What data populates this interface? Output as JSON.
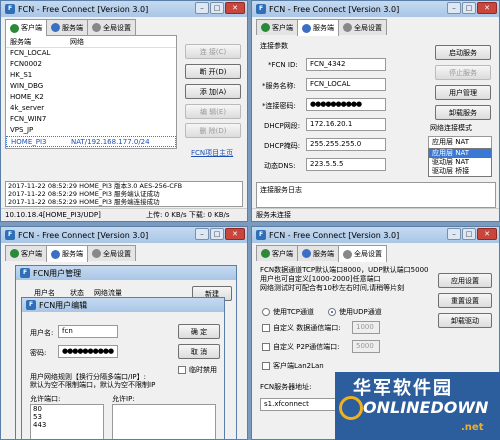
{
  "windows": {
    "tl": {
      "title": "FCN - Free Connect [Version 3.0]",
      "tabs": [
        "客户端",
        "服务端",
        "全局设置"
      ],
      "list_headers": [
        "服务端",
        "网络"
      ],
      "servers": [
        {
          "name": "FCN_LOCAL",
          "net": ""
        },
        {
          "name": "FCN0002",
          "net": ""
        },
        {
          "name": "HK_S1",
          "net": ""
        },
        {
          "name": "WIN_DBG",
          "net": ""
        },
        {
          "name": "HOME_K2",
          "net": ""
        },
        {
          "name": "4k_server",
          "net": ""
        },
        {
          "name": "FCN_WIN7",
          "net": ""
        },
        {
          "name": "VPS_JP",
          "net": ""
        },
        {
          "name": "HOME_PI3",
          "net": "NAT/192.168.177.0/24"
        }
      ],
      "buttons": {
        "connect": "连 接(C)",
        "disconnect": "断 开(D)",
        "add": "添 加(A)",
        "edit": "编 辑(E)",
        "delete": "删 除(D)"
      },
      "link": "FCN项目主页",
      "logs": [
        "2017-11-22 08:52:29 HOME_PI3 版本3.0 AES-256-CFB",
        "2017-11-22 08:52:29 HOME_PI3 服务端认证成功",
        "2017-11-22 08:52:29 HOME_PI3 服务端连接成功"
      ],
      "status_left": "10.10.18.4[HOME_PI3/UDP]",
      "status_right": "上传: 0 KB/s  下载: 0 KB/s"
    },
    "tr": {
      "title": "FCN - Free Connect [Version 3.0]",
      "tabs": [
        "客户端",
        "服务端",
        "全局设置"
      ],
      "section": "连接参数",
      "fields": [
        {
          "label": "*FCN ID:",
          "value": "FCN_4342"
        },
        {
          "label": "*服务名称:",
          "value": "FCN_LOCAL"
        },
        {
          "label": "*连接密码:",
          "value": "●●●●●●●●●●"
        },
        {
          "label": "DHCP网段:",
          "value": "172.16.20.1"
        },
        {
          "label": "DHCP掩码:",
          "value": "255.255.255.0"
        },
        {
          "label": "动态DNS:",
          "value": "223.5.5.5"
        }
      ],
      "buttons": {
        "start": "启动服务",
        "stop": "停止服务",
        "user": "用户管理",
        "uninstall": "卸载服务"
      },
      "mode_label": "网络连接模式",
      "mode_selected": "应用层 NAT",
      "mode_options": [
        "应用层 NAT",
        "驱动层 NAT",
        "驱动层 桥接"
      ],
      "log_label": "连接服务日志",
      "status": "服务未连接"
    },
    "bl": {
      "title": "FCN - Free Connect [Version 3.0]",
      "tabs": [
        "客户端",
        "服务端",
        "全局设置"
      ],
      "um_title": "FCN用户管理",
      "um_headers": [
        "用户名",
        "状态",
        "网络流量"
      ],
      "um_new": "新建",
      "ue_title": "FCN用户编辑",
      "username_label": "用户名:",
      "username": "fcn",
      "password_label": "密码:",
      "password": "●●●●●●●●●●",
      "ok": "确 定",
      "cancel": "取 消",
      "temp": "临时禁用",
      "note1": "用户网络规则【换行分隔多端口/IP】:",
      "note2": "默认为空不限制端口，默认为空不限制IP",
      "ports_label": "允许端口:",
      "ips_label": "允许IP:",
      "ports": [
        "80",
        "53",
        "443"
      ]
    },
    "br": {
      "title": "FCN - Free Connect [Version 3.0]",
      "tabs": [
        "客户端",
        "服务端",
        "全局设置"
      ],
      "info": [
        "FCN数据通道TCP默认端口8000，UDP默认端口5000",
        "用户也可自定义[1000-2000]任意端口",
        "网络测试时可配合有10秒左右时间,请稍等片刻"
      ],
      "buttons": {
        "apply": "应用设置",
        "reset": "重置设置",
        "uninstall": "卸载驱动"
      },
      "tcp": "使用TCP通道",
      "udp": "使用UDP通道",
      "custom_data": "自定义 数据通信端口:",
      "data_port": "1000",
      "custom_p2p": "自定义  P2P通信端口:",
      "p2p_port": "5000",
      "lan": "客户端Lan2Lan",
      "addr_label": "FCN服务器地址:",
      "addr": "s1.xfconnect"
    }
  },
  "watermark": {
    "cn": "华军软件园",
    "en": "ONLINEDOWN",
    "suffix": ".net"
  }
}
